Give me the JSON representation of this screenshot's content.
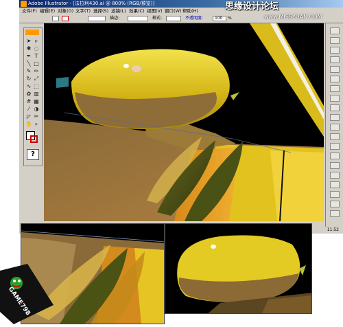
{
  "window": {
    "title": "Adobe Illustrator - [法拉利430.ai @ 800% (RGB/预览)]"
  },
  "menu": {
    "items": [
      "文件(F)",
      "编辑(E)",
      "对象(O)",
      "文字(T)",
      "选择(S)",
      "滤镜(L)",
      "效果(C)",
      "视图(V)",
      "窗口(W)",
      "帮助(H)"
    ]
  },
  "toolbar": {
    "stroke_label": "描边:",
    "style_label": "样式:",
    "opacity_label": "不透明度:",
    "opacity_value": "100",
    "opacity_unit": "%"
  },
  "statusbar": {
    "time": "11:52"
  },
  "watermark": {
    "text": "思缘设计论坛",
    "url": "www.MISSYUAN.COM"
  },
  "logo": {
    "text": "GAME798"
  },
  "colors": {
    "title_bar": "#0a246a",
    "canvas_bg": "#000000",
    "mirror_yellow": "#d6b81a",
    "body_brown": "#8a6a38",
    "dark_olive": "#3f4414"
  },
  "icons": {
    "tools": [
      "selection-icon",
      "direct-select-icon",
      "magic-wand-icon",
      "lasso-icon",
      "pen-icon",
      "type-icon",
      "line-icon",
      "rectangle-icon",
      "brush-icon",
      "pencil-icon",
      "rotate-icon",
      "scale-icon",
      "warp-icon",
      "free-transform-icon",
      "symbol-sprayer-icon",
      "graph-icon",
      "mesh-icon",
      "gradient-icon",
      "eyedropper-icon",
      "blend-icon",
      "slice-icon",
      "scissors-icon",
      "hand-icon",
      "zoom-icon",
      "fill-stroke-icon",
      "help-icon"
    ]
  }
}
